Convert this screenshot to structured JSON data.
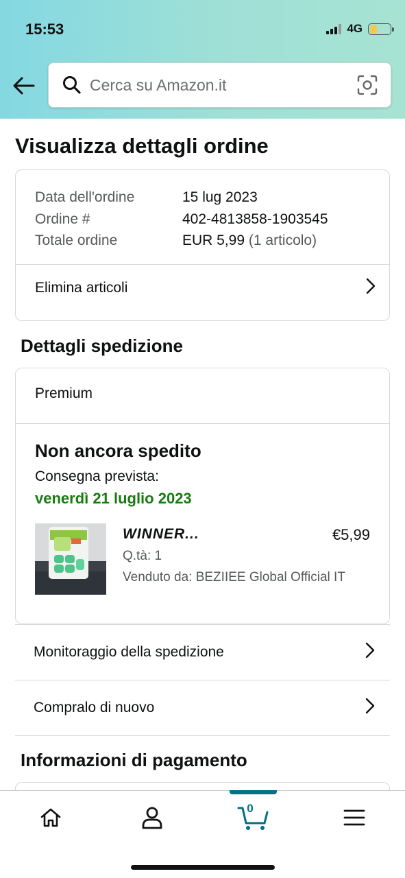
{
  "status_bar": {
    "time": "15:53",
    "network": "4G",
    "battery_level": 0.35,
    "icons": [
      "signal-icon",
      "battery-icon"
    ]
  },
  "search": {
    "placeholder": "Cerca su Amazon.it",
    "icons": [
      "back-arrow-icon",
      "search-icon",
      "camera-scan-icon"
    ]
  },
  "page": {
    "title": "Visualizza dettagli ordine"
  },
  "order": {
    "date_label": "Data dell'ordine",
    "date_value": "15 lug 2023",
    "number_label": "Ordine #",
    "number_value": "402-4813858-1903545",
    "total_label": "Totale ordine",
    "total_value": "EUR 5,99",
    "total_items": "(1 articolo)",
    "delete_items_label": "Elimina articoli"
  },
  "shipping": {
    "section_title": "Dettagli spedizione",
    "method": "Premium",
    "status": "Non ancora spedito",
    "expected_label": "Consegna prevista:",
    "expected_date": "venerdì 21 luglio 2023",
    "date_color": "#1a7a12",
    "product": {
      "title": "WINNER...",
      "price": "€5,99",
      "quantity": "Q.tà: 1",
      "seller": "Venduto da: BEZIIEE Global Official IT"
    }
  },
  "actions": {
    "tracking_label": "Monitoraggio della spedizione",
    "buy_again_label": "Compralo di nuovo"
  },
  "payment": {
    "section_title": "Informazioni di pagamento"
  },
  "bottom_nav": {
    "items": [
      "home-icon",
      "account-icon",
      "cart-icon",
      "menu-icon"
    ],
    "cart_count": "0",
    "active_color": "#007185"
  }
}
